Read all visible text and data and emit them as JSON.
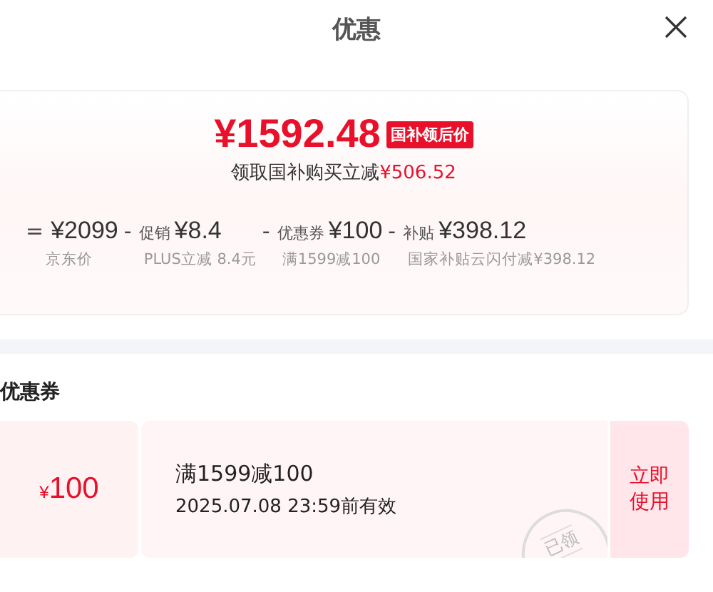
{
  "header": {
    "title": "优惠"
  },
  "summary": {
    "price": "¥1592.48",
    "price_tag": "国补领后价",
    "subtitle": "领取国补购买立减",
    "saving": "¥506.52",
    "breakdown": [
      {
        "operator": "=",
        "amount": "¥2099",
        "note": "京东价"
      },
      {
        "operator": "-",
        "label": "促销",
        "amount": "¥8.4",
        "note": "PLUS立减 8.4元"
      },
      {
        "operator": "-",
        "label": "优惠券",
        "amount": "¥100",
        "note": "满1599减100"
      },
      {
        "operator": "-",
        "label": "补贴",
        "amount": "¥398.12",
        "note": "国家补贴云闪付减¥398.12"
      }
    ]
  },
  "coupons": {
    "heading": "优惠券",
    "items": [
      {
        "currency": "¥",
        "amount": "100",
        "condition": "满1599减100",
        "validity": "2025.07.08 23:59前有效",
        "stamp": "已领",
        "action": "立即使用"
      }
    ]
  }
}
